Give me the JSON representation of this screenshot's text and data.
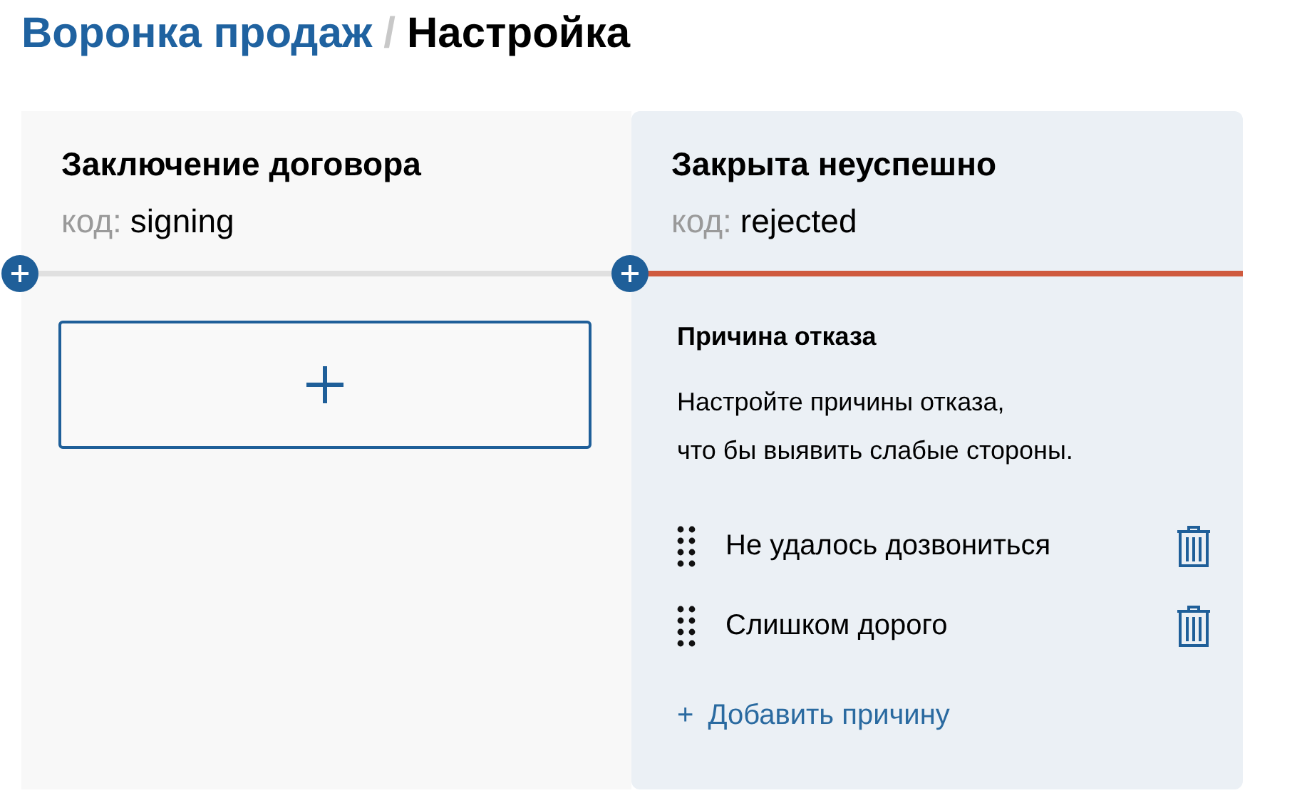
{
  "breadcrumb": {
    "parent": "Воронка продаж",
    "separator": "/",
    "current": "Настройка"
  },
  "stages": [
    {
      "name": "Заключение договора",
      "code_label": "код:",
      "code": "signing",
      "selected": false,
      "color": "#e0e0e0",
      "kind": "empty"
    },
    {
      "name": "Закрыта неуспешно",
      "code_label": "код:",
      "code": "rejected",
      "selected": true,
      "color": "#cf5a3e",
      "kind": "reasons",
      "section_title": "Причина отказа",
      "description": "Настройте причины отказа,\nчто бы выявить слабые стороны.",
      "reasons": [
        "Не удалось дозвониться",
        "Слишком дорого"
      ],
      "add_link": "Добавить причину",
      "add_link_icon": "+"
    }
  ]
}
